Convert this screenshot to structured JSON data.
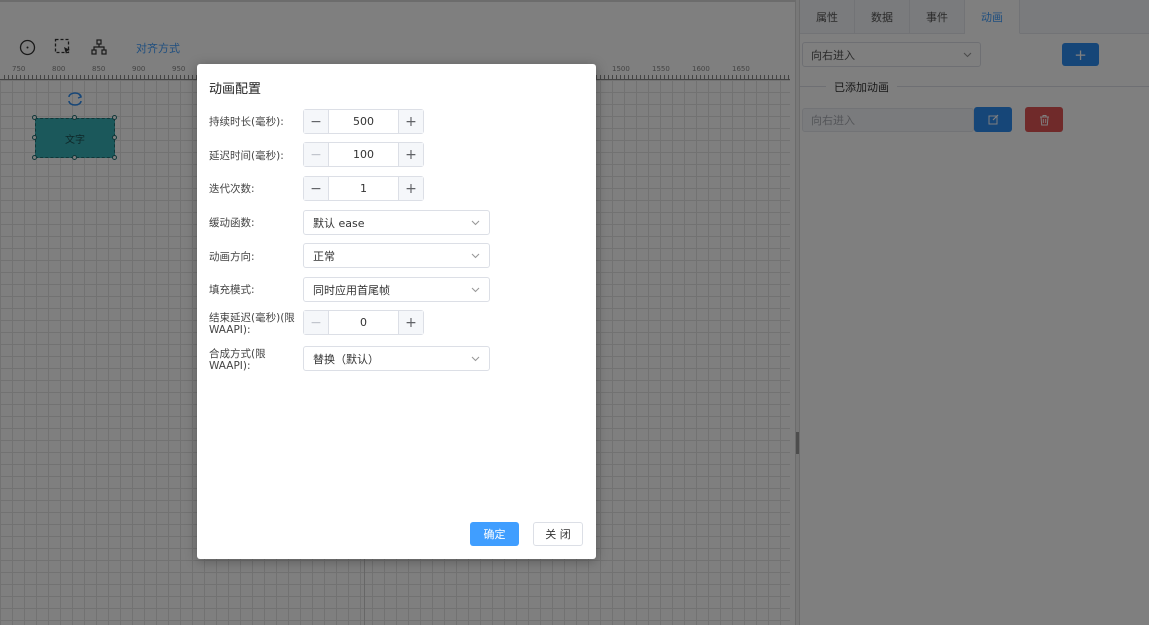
{
  "toolbar": {
    "align_label": "对齐方式"
  },
  "ruler": {
    "left_labels": [
      "750",
      "800",
      "850",
      "900",
      "950"
    ],
    "right_labels": [
      "1500",
      "1550",
      "1600",
      "1650"
    ]
  },
  "canvas": {
    "widget_text": "文字"
  },
  "panel": {
    "tabs": [
      "属性",
      "数据",
      "事件",
      "动画"
    ],
    "active_tab": "动画",
    "anim_select_value": "向右进入",
    "add_label": "+",
    "added_divider": "已添加动画",
    "added_items": [
      "向右进入"
    ]
  },
  "dialog": {
    "title": "动画配置",
    "fields": {
      "duration": {
        "label": "持续时长(毫秒):",
        "value": "500"
      },
      "delay": {
        "label": "延迟时间(毫秒):",
        "value": "100"
      },
      "iterations": {
        "label": "迭代次数:",
        "value": "1"
      },
      "easing": {
        "label": "缓动函数:",
        "value": "默认 ease"
      },
      "direction": {
        "label": "动画方向:",
        "value": "正常"
      },
      "fill": {
        "label": "填充模式:",
        "value": "同时应用首尾帧"
      },
      "end_delay": {
        "label": "结束延迟(毫秒)(限WAAPI):",
        "value": "0"
      },
      "composite": {
        "label": "合成方式(限WAAPI):",
        "value": "替换（默认）"
      }
    },
    "ok_label": "确定",
    "close_label": "关 闭"
  },
  "colors": {
    "primary": "#409eff",
    "danger": "#e05555",
    "widget": "#36b1b6"
  }
}
